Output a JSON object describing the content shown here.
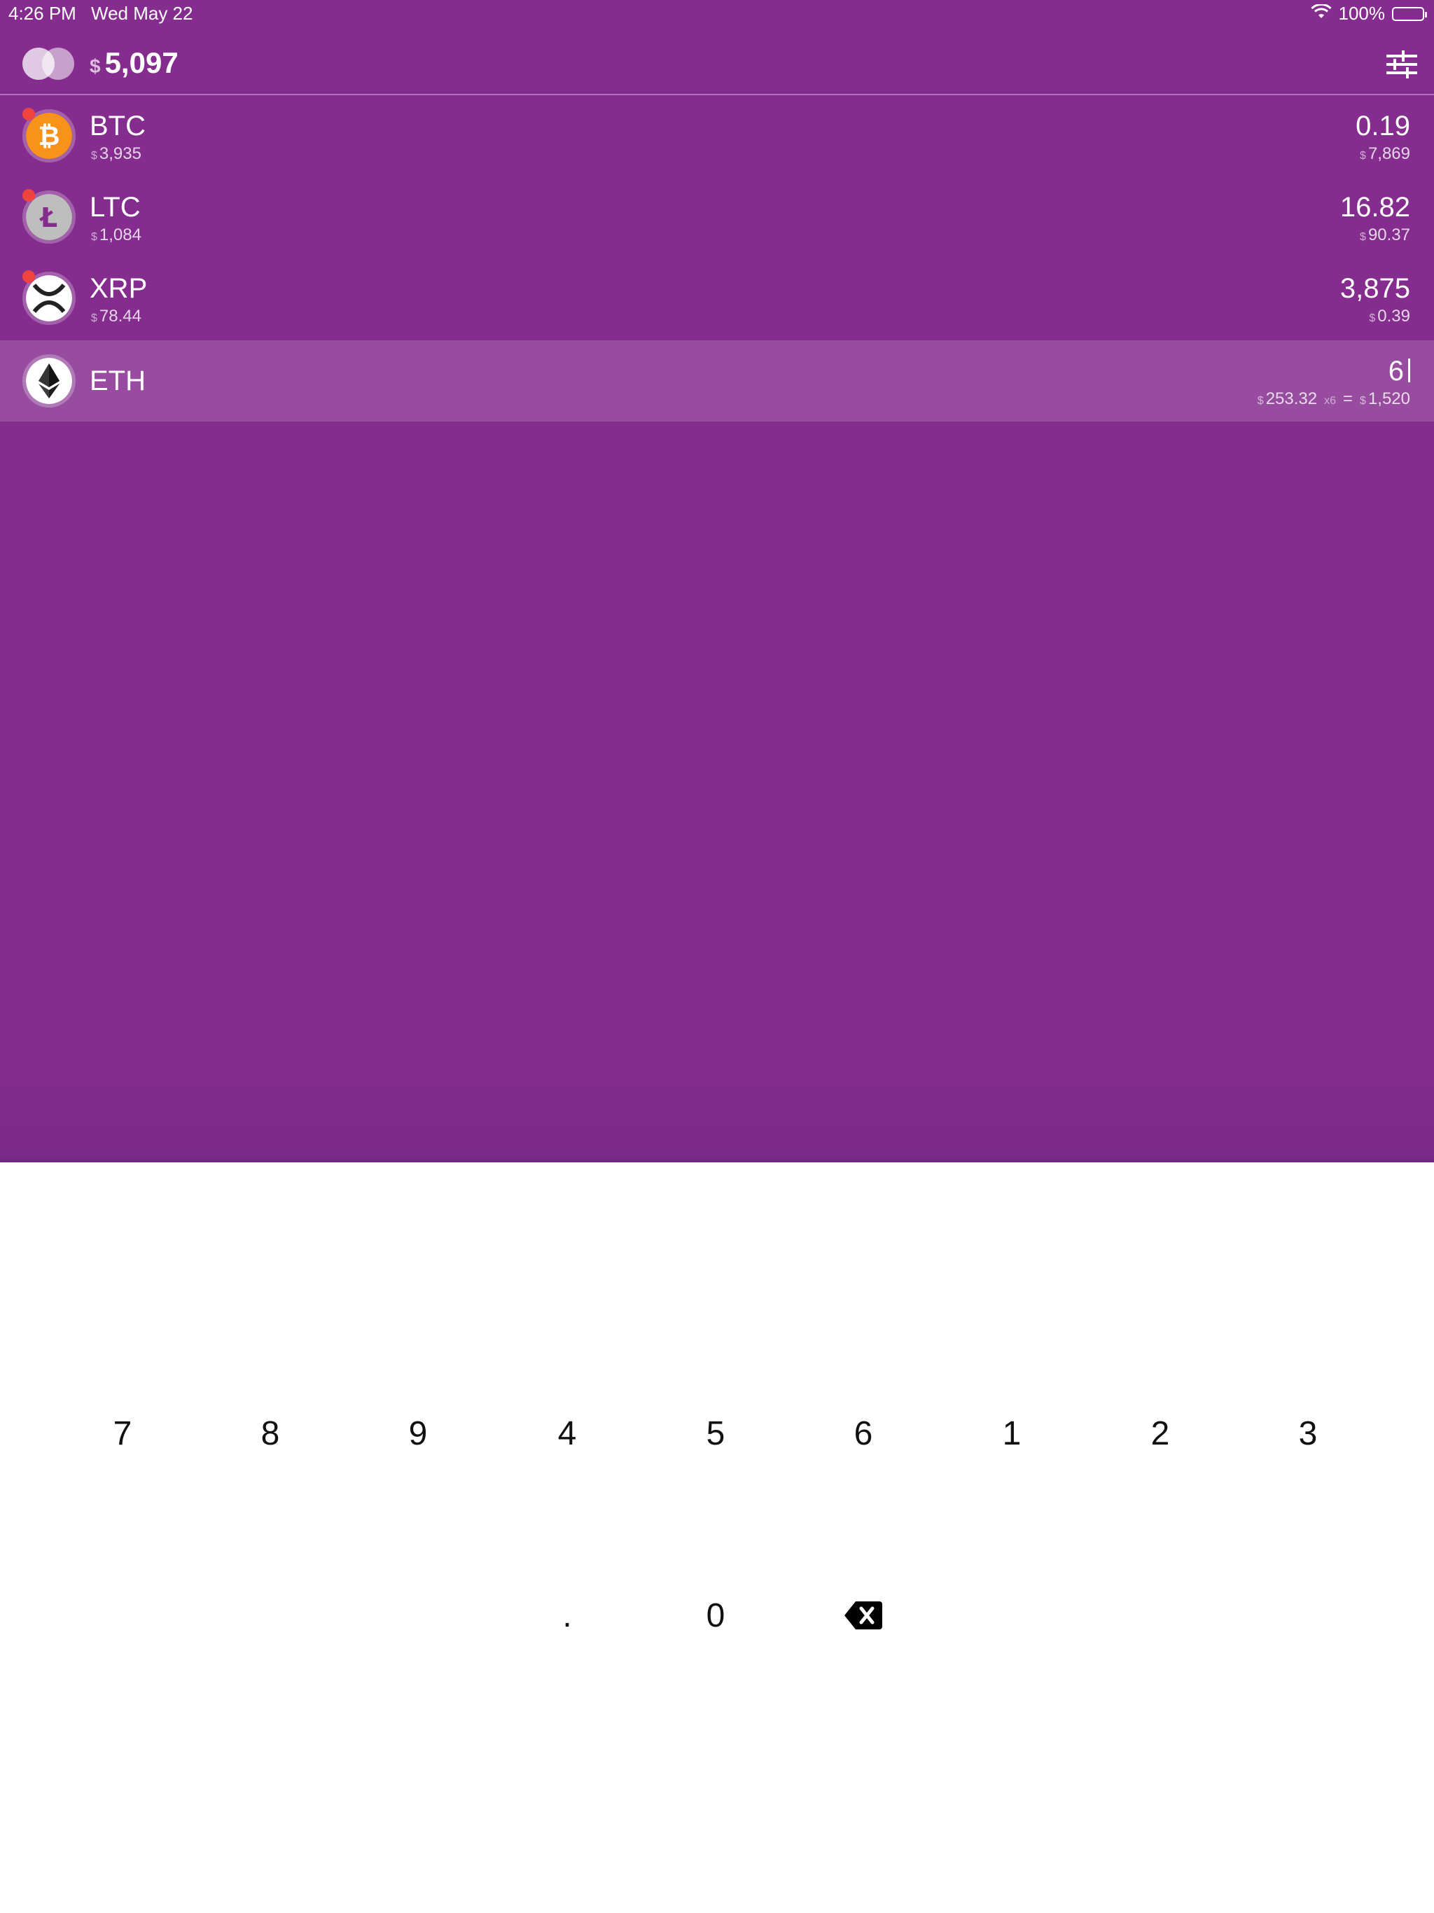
{
  "status_bar": {
    "time": "4:26 PM",
    "date": "Wed May 22",
    "battery": "100%"
  },
  "header": {
    "currency_symbol": "$",
    "total": "5,097"
  },
  "coins": [
    {
      "symbol": "BTC",
      "value": "3,935",
      "amount": "0.19",
      "price": "7,869",
      "alert": true,
      "color": "#f7931a"
    },
    {
      "symbol": "LTC",
      "value": "1,084",
      "amount": "16.82",
      "price": "90.37",
      "alert": true,
      "color": "#bebebe"
    },
    {
      "symbol": "XRP",
      "value": "78.44",
      "amount": "3,875",
      "price": "0.39",
      "alert": true,
      "color": "#ffffff"
    },
    {
      "symbol": "ETH",
      "amount": "6",
      "price": "253.32",
      "multiplier": "x6",
      "equals": "=",
      "result": "1,520",
      "selected": true,
      "color": "#ffffff"
    }
  ],
  "keypad": {
    "digits_row": [
      "7",
      "8",
      "9",
      "4",
      "5",
      "6",
      "1",
      "2",
      "3"
    ],
    "bottom_row": [
      ".",
      "0"
    ],
    "backspace_icon": "backspace-icon"
  }
}
